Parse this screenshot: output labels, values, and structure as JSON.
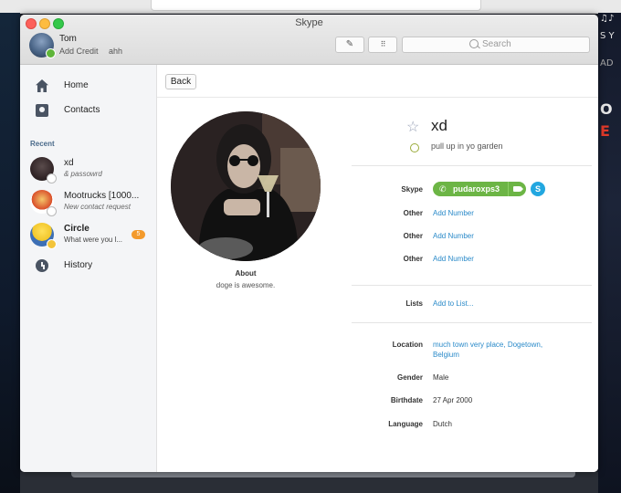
{
  "window": {
    "title": "Skype"
  },
  "account": {
    "name": "Tom",
    "credit_label": "Add Credit",
    "mood": "ahh"
  },
  "toolbar": {
    "compose_icon": "compose-icon",
    "dialpad_icon": "dialpad-icon",
    "search_placeholder": "Search"
  },
  "sidebar": {
    "nav": [
      {
        "label": "Home",
        "icon": "home-icon"
      },
      {
        "label": "Contacts",
        "icon": "contacts-icon"
      }
    ],
    "recent_heading": "Recent",
    "recent": [
      {
        "name": "xd",
        "subtitle": "& passowrd",
        "bold": false,
        "badge": ""
      },
      {
        "name": "Mootrucks [1000...",
        "subtitle": "New contact request",
        "bold": false,
        "badge": ""
      },
      {
        "name": "Circle",
        "subtitle": "What were you l...",
        "bold": true,
        "badge": "5"
      }
    ],
    "history": {
      "label": "History",
      "icon": "history-icon"
    }
  },
  "main": {
    "back_label": "Back",
    "about_heading": "About",
    "about_text": "doge is awesome.",
    "contact": {
      "name": "xd",
      "mood": "pull up in yo garden"
    },
    "skype": {
      "label": "Skype",
      "username": "pudaroxps3"
    },
    "other_rows": [
      {
        "label": "Other",
        "value": "Add Number"
      },
      {
        "label": "Other",
        "value": "Add Number"
      },
      {
        "label": "Other",
        "value": "Add Number"
      }
    ],
    "lists": {
      "label": "Lists",
      "value": "Add to List..."
    },
    "details": {
      "location_label": "Location",
      "location_line1": "much town very place, Dogetown,",
      "location_line2": "Belgium",
      "gender_label": "Gender",
      "gender": "Male",
      "birthdate_label": "Birthdate",
      "birthdate": "27 Apr 2000",
      "language_label": "Language",
      "language": "Dutch"
    }
  },
  "background_text": {
    "right_top": "S Y",
    "right_mid": "AD",
    "right_o": "O",
    "right_e": "E",
    "right_notes": "♫♪"
  },
  "colors": {
    "accent_link": "#2a8ac9",
    "skype_green": "#6cb545",
    "badge_orange": "#f39a2c"
  }
}
